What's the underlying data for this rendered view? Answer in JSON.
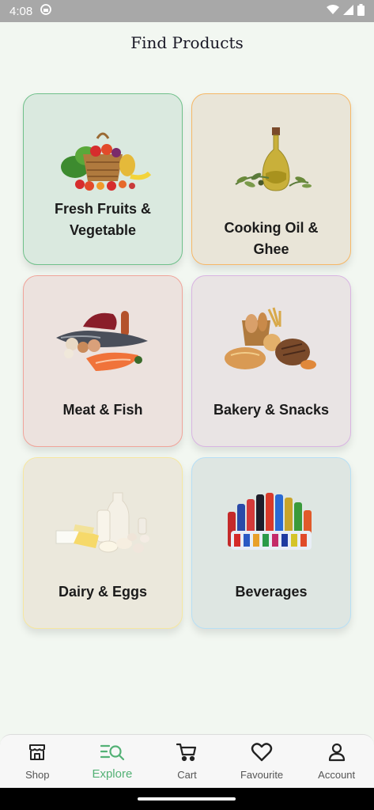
{
  "status_bar": {
    "time": "4:08"
  },
  "header": {
    "title": "Find Products"
  },
  "categories": [
    {
      "label": "Fresh Fruits & Vegetable",
      "image": "fruits-vegetables-basket",
      "bg": "#dae9df",
      "border": "#6fc08a"
    },
    {
      "label": "Cooking Oil & Ghee",
      "image": "olive-oil-bottle",
      "bg": "#e9e5d8",
      "border": "#f6b766"
    },
    {
      "label": "Meat & Fish",
      "image": "meat-and-fish",
      "bg": "#ece2de",
      "border": "#f0a49a"
    },
    {
      "label": "Bakery & Snacks",
      "image": "bread-and-bakery",
      "bg": "#e9e4e4",
      "border": "#d9b4e2"
    },
    {
      "label": "Dairy & Eggs",
      "image": "dairy-and-eggs",
      "bg": "#ebe8dc",
      "border": "#f6e7a0"
    },
    {
      "label": "Beverages",
      "image": "soda-bottles",
      "bg": "#dee6e2",
      "border": "#b7dff5"
    }
  ],
  "nav": [
    {
      "label": "Shop",
      "icon": "store-icon"
    },
    {
      "label": "Explore",
      "icon": "explore-search-icon",
      "active": true
    },
    {
      "label": "Cart",
      "icon": "cart-icon"
    },
    {
      "label": "Favourite",
      "icon": "heart-icon"
    },
    {
      "label": "Account",
      "icon": "person-icon"
    }
  ],
  "colors": {
    "accent": "#53b175",
    "background": "#f2f7f1"
  }
}
